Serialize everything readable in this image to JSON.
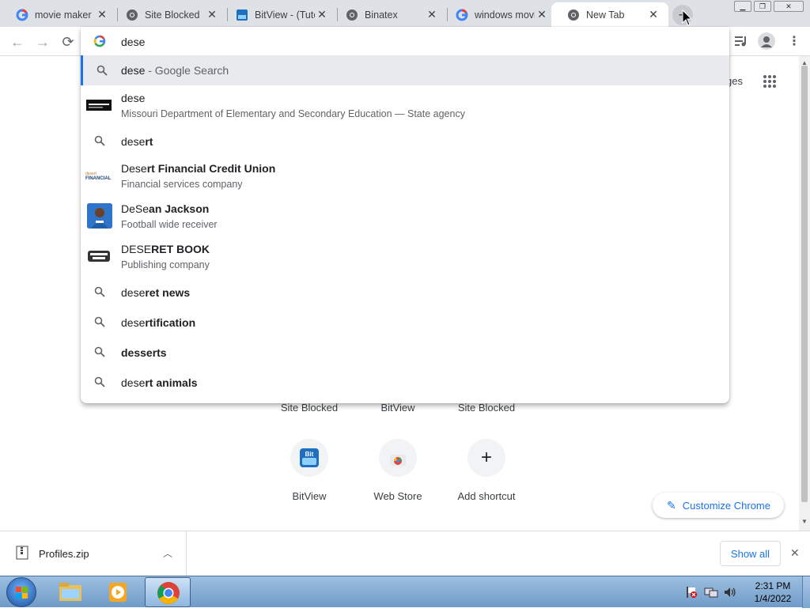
{
  "tabs": [
    {
      "title": "movie maker",
      "favicon": "google-icon"
    },
    {
      "title": "Site Blocked",
      "favicon": "chrome-icon"
    },
    {
      "title": "BitView - (Tuto",
      "favicon": "bitview-icon"
    },
    {
      "title": "Binatex",
      "favicon": "chrome-icon"
    },
    {
      "title": "windows movie",
      "favicon": "google-icon"
    },
    {
      "title": "New Tab",
      "favicon": "chrome-icon",
      "active": true
    }
  ],
  "omnibox": {
    "value": "dese"
  },
  "suggestions": [
    {
      "pre": "dese",
      "bold": "",
      "suffix": " - Google Search"
    },
    {
      "pre": "dese",
      "bold": "",
      "sub": "Missouri Department of Elementary and Secondary Education — State agency"
    },
    {
      "pre": "dese",
      "bold": "rt"
    },
    {
      "pre": "Dese",
      "bold": "rt Financial Credit Union",
      "sub": "Financial services company"
    },
    {
      "pre": "DeSe",
      "bold": "an Jackson",
      "sub": "Football wide receiver"
    },
    {
      "pre": "DESE",
      "bold": "RET BOOK",
      "sub": "Publishing company"
    },
    {
      "pre": "dese",
      "bold": "ret news"
    },
    {
      "pre": "dese",
      "bold": "rtification"
    },
    {
      "pre": "",
      "bold": "desserts"
    },
    {
      "pre": "dese",
      "bold": "rt animals"
    }
  ],
  "shortcuts_row1": [
    "Site Blocked",
    "BitView",
    "Site Blocked"
  ],
  "shortcuts_row2": [
    {
      "label": "BitView",
      "icon": "bitview-icon"
    },
    {
      "label": "Web Store",
      "icon": "web-store-icon"
    },
    {
      "label": "Add shortcut",
      "icon": "plus-icon"
    }
  ],
  "header_right_text": "ges",
  "customize_label": "Customize Chrome",
  "download": {
    "filename": "Profiles.zip",
    "show_all": "Show all"
  },
  "taskbar": {
    "time": "2:31 PM",
    "date": "1/4/2022"
  },
  "colors": {
    "accent": "#1a73e8",
    "tab_strip": "#dee1e6"
  }
}
